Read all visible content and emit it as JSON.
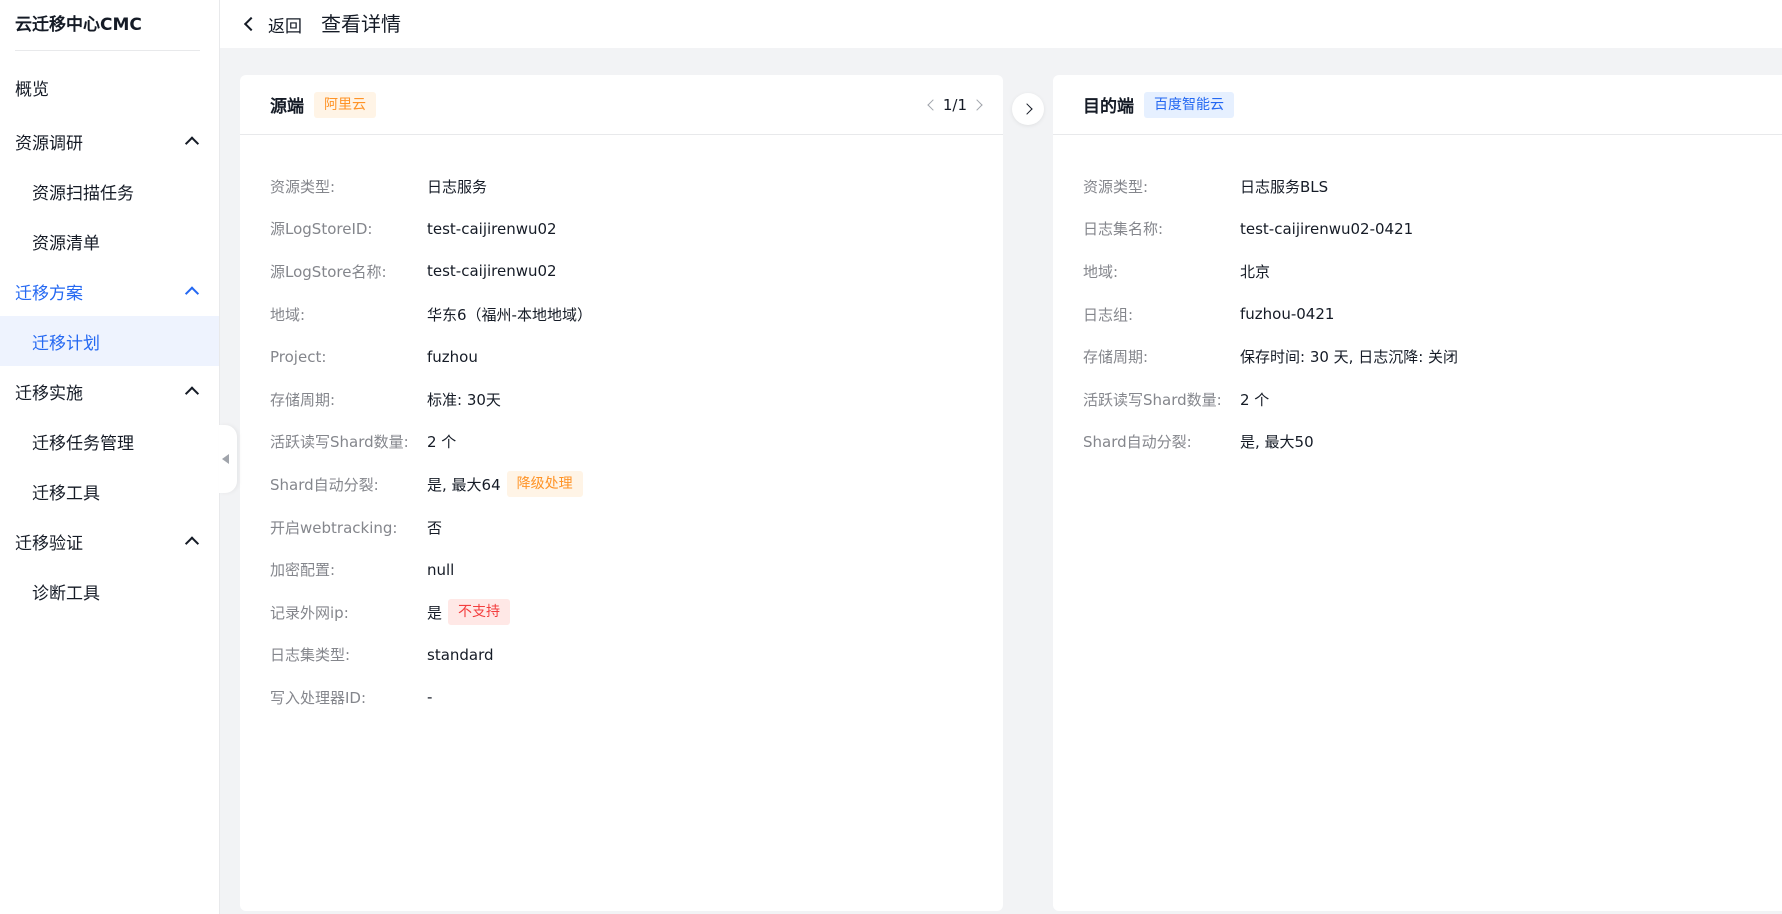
{
  "sidebar": {
    "app_title": "云迁移中心CMC",
    "items": [
      {
        "label": "概览"
      },
      {
        "label": "资源调研"
      },
      {
        "label": "资源扫描任务"
      },
      {
        "label": "资源清单"
      },
      {
        "label": "迁移方案"
      },
      {
        "label": "迁移计划"
      },
      {
        "label": "迁移实施"
      },
      {
        "label": "迁移任务管理"
      },
      {
        "label": "迁移工具"
      },
      {
        "label": "迁移验证"
      },
      {
        "label": "诊断工具"
      }
    ]
  },
  "header": {
    "back_label": "返回",
    "title": "查看详情"
  },
  "source": {
    "title": "源端",
    "provider": "阿里云",
    "pager": "1/1",
    "rows": [
      {
        "label": "资源类型:",
        "value": "日志服务"
      },
      {
        "label": "源LogStoreID:",
        "value": "test-caijirenwu02"
      },
      {
        "label": "源LogStore名称:",
        "value": "test-caijirenwu02"
      },
      {
        "label": "地域:",
        "value": "华东6（福州-本地地域）"
      },
      {
        "label": "Project:",
        "value": "fuzhou"
      },
      {
        "label": "存储周期:",
        "value": "标准: 30天"
      },
      {
        "label": "活跃读写Shard数量:",
        "value": "2 个"
      },
      {
        "label": "Shard自动分裂:",
        "value": "是, 最大64",
        "tag": "降级处理"
      },
      {
        "label": "开启webtracking:",
        "value": "否"
      },
      {
        "label": "加密配置:",
        "value": "null"
      },
      {
        "label": "记录外网ip:",
        "value": "是",
        "tag": "不支持"
      },
      {
        "label": "日志集类型:",
        "value": "standard"
      },
      {
        "label": "写入处理器ID:",
        "value": "-"
      }
    ]
  },
  "target": {
    "title": "目的端",
    "provider": "百度智能云",
    "rows": [
      {
        "label": "资源类型:",
        "value": "日志服务BLS"
      },
      {
        "label": "日志集名称:",
        "value": "test-caijirenwu02-0421"
      },
      {
        "label": "地域:",
        "value": "北京"
      },
      {
        "label": "日志组:",
        "value": "fuzhou-0421"
      },
      {
        "label": "存储周期:",
        "value": "保存时间: 30 天, 日志沉降: 关闭"
      },
      {
        "label": "活跃读写Shard数量:",
        "value": "2 个"
      },
      {
        "label": "Shard自动分裂:",
        "value": "是, 最大50"
      }
    ]
  },
  "colors": {
    "accent": "#2468f2",
    "warning": "#ff9326",
    "error": "#f33e3e",
    "muted": "#84868c"
  },
  "icons": {
    "back": "chevron-left-icon",
    "expand": "chevron-up-icon",
    "switch": "chevron-right-icon",
    "collapse": "triangle-left-icon"
  }
}
